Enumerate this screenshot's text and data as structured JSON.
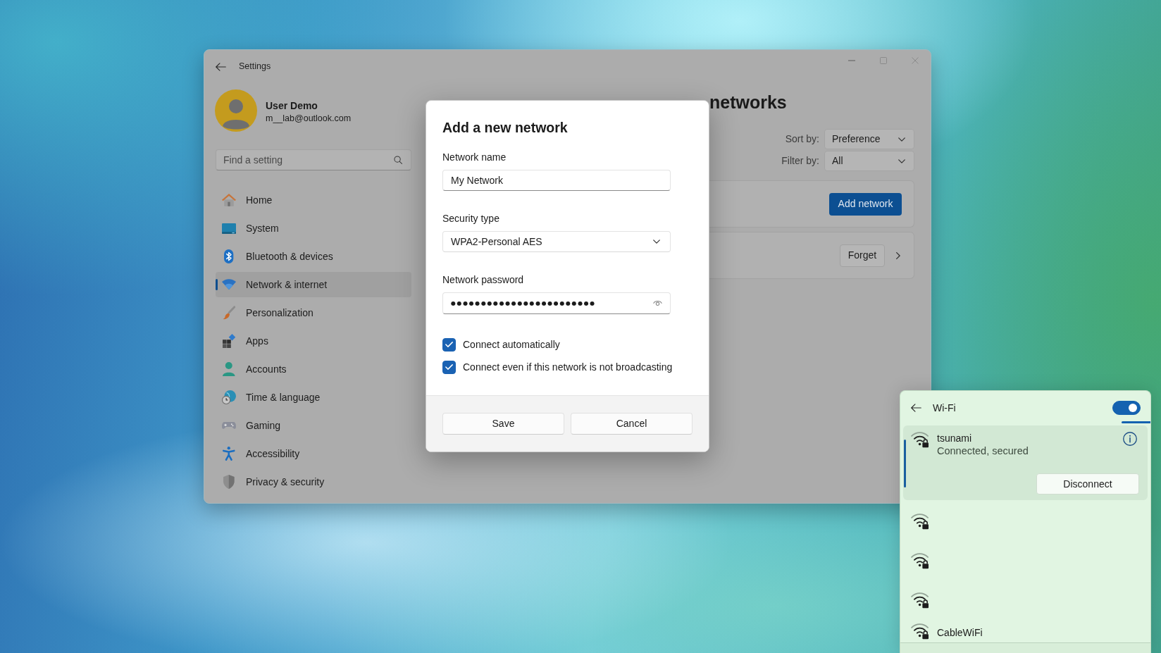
{
  "window": {
    "title": "Settings"
  },
  "profile": {
    "name": "User Demo",
    "email": "m__lab@outlook.com"
  },
  "search": {
    "placeholder": "Find a setting"
  },
  "sidebar": {
    "items": [
      {
        "label": "Home",
        "selected": false
      },
      {
        "label": "System",
        "selected": false
      },
      {
        "label": "Bluetooth & devices",
        "selected": false
      },
      {
        "label": "Network & internet",
        "selected": true
      },
      {
        "label": "Personalization",
        "selected": false
      },
      {
        "label": "Apps",
        "selected": false
      },
      {
        "label": "Accounts",
        "selected": false
      },
      {
        "label": "Time & language",
        "selected": false
      },
      {
        "label": "Gaming",
        "selected": false
      },
      {
        "label": "Accessibility",
        "selected": false
      },
      {
        "label": "Privacy & security",
        "selected": false
      }
    ]
  },
  "page": {
    "title": "networks",
    "sort": {
      "label": "Sort by:",
      "value": "Preference"
    },
    "filter": {
      "label": "Filter by:",
      "value": "All"
    },
    "add_button": "Add network",
    "forget_button": "Forget"
  },
  "dialog": {
    "title": "Add a new network",
    "fields": [
      {
        "kind": "text",
        "label": "Network name",
        "value": "My Network"
      },
      {
        "kind": "dropdown",
        "label": "Security type",
        "value": "WPA2-Personal AES"
      },
      {
        "kind": "password",
        "label": "Network password",
        "value": "●●●●●●●●●●●●●●●●●●●●●●●●"
      }
    ],
    "checkboxes": [
      {
        "label": "Connect automatically",
        "checked": true
      },
      {
        "label": "Connect even if this network is not broadcasting",
        "checked": true
      }
    ],
    "buttons": [
      "Save",
      "Cancel"
    ]
  },
  "wifi_panel": {
    "title": "Wi-Fi",
    "on": true,
    "networks": [
      {
        "name": "tsunami",
        "status": "Connected, secured",
        "selected": true,
        "button": "Disconnect"
      },
      {
        "selected": false
      },
      {
        "selected": false
      },
      {
        "selected": false
      },
      {
        "name": "CableWiFi",
        "selected": false
      }
    ]
  }
}
